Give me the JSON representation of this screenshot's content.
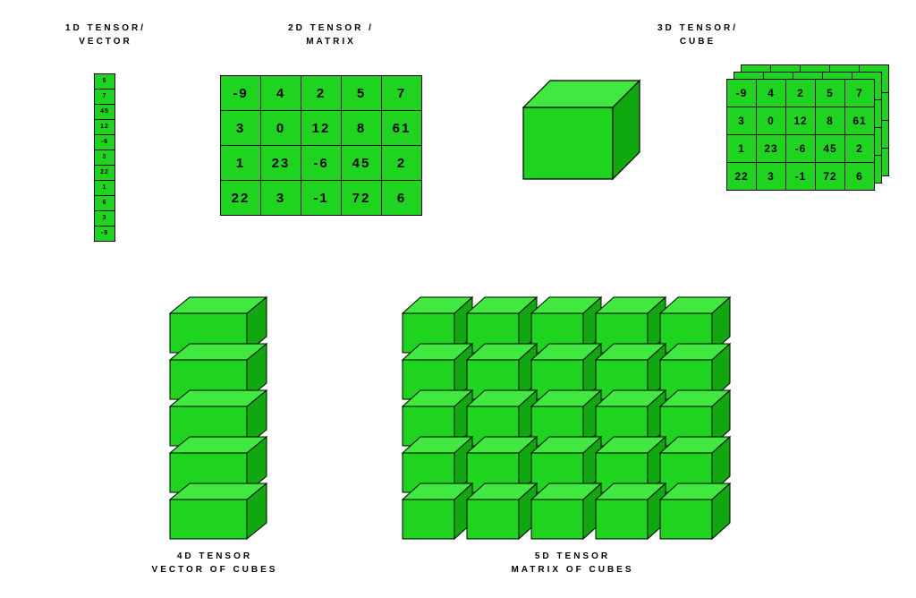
{
  "titles": {
    "t1a": "1D TENSOR/",
    "t1b": "VECTOR",
    "t2a": "2D TENSOR /",
    "t2b": "MATRIX",
    "t3a": "3D TENSOR/",
    "t3b": "CUBE",
    "t4a": "4D TENSOR",
    "t4b": "VECTOR OF CUBES",
    "t5a": "5D TENSOR",
    "t5b": "MATRIX OF CUBES"
  },
  "vector1d": [
    "5",
    "7",
    "45",
    "12",
    "-6",
    "3",
    "22",
    "1",
    "6",
    "3",
    "-9"
  ],
  "matrix2d": [
    [
      "-9",
      "4",
      "2",
      "5",
      "7"
    ],
    [
      "3",
      "0",
      "12",
      "8",
      "61"
    ],
    [
      "1",
      "23",
      "-6",
      "45",
      "2"
    ],
    [
      "22",
      "3",
      "-1",
      "72",
      "6"
    ]
  ],
  "matrix3d": [
    [
      "-9",
      "4",
      "2",
      "5",
      "7"
    ],
    [
      "3",
      "0",
      "12",
      "8",
      "61"
    ],
    [
      "1",
      "23",
      "-6",
      "45",
      "2"
    ],
    [
      "22",
      "3",
      "-1",
      "72",
      "6"
    ]
  ],
  "colors": {
    "green": "#1ed41e",
    "darkgreen": "#0fa80f",
    "lightgreen": "#40e840"
  },
  "chart_data": {
    "type": "table",
    "note": "Diagram illustrating tensor dimensionality 1D through 5D",
    "vector_1d": [
      5,
      7,
      45,
      12,
      -6,
      3,
      22,
      1,
      6,
      3,
      -9
    ],
    "matrix_2d": [
      [
        -9,
        4,
        2,
        5,
        7
      ],
      [
        3,
        0,
        12,
        8,
        61
      ],
      [
        1,
        23,
        -6,
        45,
        2
      ],
      [
        22,
        3,
        -1,
        72,
        6
      ]
    ],
    "cube_3d_slice": [
      [
        -9,
        4,
        2,
        5,
        7
      ],
      [
        3,
        0,
        12,
        8,
        61
      ],
      [
        1,
        23,
        -6,
        45,
        2
      ],
      [
        22,
        3,
        -1,
        72,
        6
      ]
    ],
    "tensor_4d_shape": "vector of 5 cubes",
    "tensor_5d_shape": "5x5 matrix of cubes"
  }
}
